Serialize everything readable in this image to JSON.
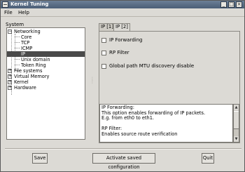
{
  "window": {
    "title": "Kernel Tuning",
    "window_menu_icon": "window-menu-icon",
    "minimize_icon": "minimize-icon",
    "maximize_icon": "maximize-icon",
    "close_icon": "close-icon"
  },
  "menubar": {
    "items": [
      "File",
      "Help"
    ]
  },
  "sidebar": {
    "group_label": "System",
    "items": [
      {
        "label": "Networking",
        "expanded": true
      },
      {
        "label": "Core"
      },
      {
        "label": "TCP"
      },
      {
        "label": "ICMP"
      },
      {
        "label": "IP",
        "selected": true
      },
      {
        "label": "Unix domain"
      },
      {
        "label": "Token Ring"
      },
      {
        "label": "File systems",
        "expanded": false
      },
      {
        "label": "Virtual Memory",
        "expanded": false
      },
      {
        "label": "Kernel",
        "expanded": false
      },
      {
        "label": "Hardware",
        "expanded": false
      }
    ],
    "expander_symbols": {
      "expanded": "⊟",
      "collapsed": "⊞"
    }
  },
  "tabs": [
    {
      "label": "IP [1]",
      "active": false
    },
    {
      "label": "IP [2]",
      "active": true
    }
  ],
  "options": [
    {
      "label": "IP Forwarding",
      "checked": false
    },
    {
      "label": "RP Filter",
      "checked": false
    },
    {
      "label": "Global path MTU discovery disable",
      "checked": false
    }
  ],
  "help_text": {
    "lines": [
      "IP Forwarding:",
      "    This option enables forwarding of IP packets.",
      "    E.g. from eth0 to eth1.",
      "",
      "RP Filter:",
      "    Enables source route verification"
    ]
  },
  "buttons": {
    "save": "Save",
    "activate": "Activate saved configuration",
    "quit": "Quit"
  },
  "colors": {
    "window_bg": "#dcdad5",
    "titlebar": "#55687f",
    "selection": "#4a4a4a"
  }
}
